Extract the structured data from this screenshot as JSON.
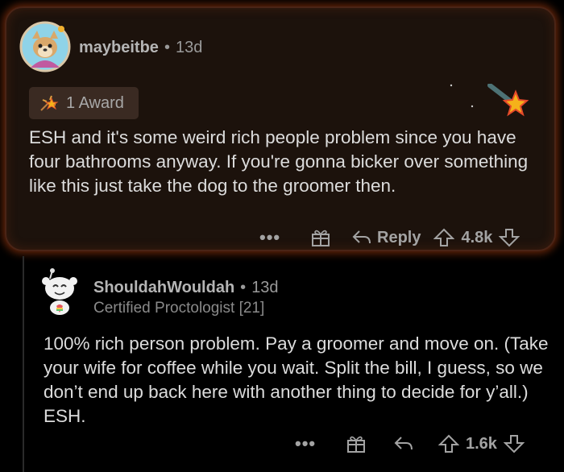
{
  "comment1": {
    "username": "maybeitbe",
    "separator": "•",
    "age": "13d",
    "award_label": "1 Award",
    "body": "ESH and it's some weird rich people problem since you have four bathrooms anyway. If you're gonna bicker over something like this just take the dog to the groomer then.",
    "more": "•••",
    "reply_label": "Reply",
    "score": "4.8k"
  },
  "comment2": {
    "username": "ShouldahWouldah",
    "separator": "•",
    "age": "13d",
    "flair": "Certified Proctologist [21]",
    "body": "100% rich person problem. Pay a groomer and move on. (Take your wife for coffee while you wait. Split the bill, I guess, so we don’t end up back here with another thing to decide for y’all.) ESH.",
    "more": "•••",
    "score": "1.6k"
  },
  "colors": {
    "background": "#000000",
    "card_bg": "#1c120c",
    "card_glow": "#dc5014",
    "text": "#dcdcdc",
    "muted": "#9a9a9a"
  },
  "icons": [
    "avatar",
    "award-icon",
    "star-sparkle",
    "more-icon",
    "gift-icon",
    "reply-icon",
    "upvote-icon",
    "downvote-icon"
  ]
}
